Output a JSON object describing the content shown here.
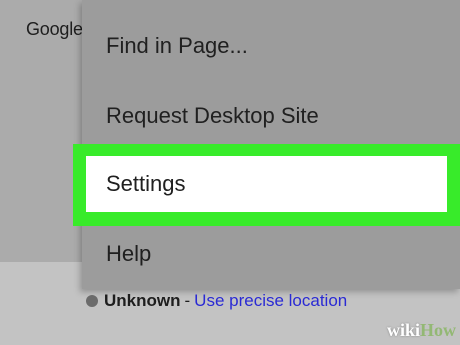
{
  "page": {
    "google_text": "Google",
    "location": {
      "status": "Unknown",
      "separator": "-",
      "link_text": "Use precise location"
    }
  },
  "menu": {
    "items": [
      {
        "label": "Find in Page..."
      },
      {
        "label": "Request Desktop Site"
      },
      {
        "label": "Settings"
      },
      {
        "label": "Help"
      }
    ],
    "highlighted_item": "Settings"
  },
  "watermark": {
    "wiki": "wiki",
    "how": "How"
  },
  "colors": {
    "highlight": "#38eb2a",
    "menu_bg": "#9c9c9c",
    "link": "#2a2ad4"
  }
}
